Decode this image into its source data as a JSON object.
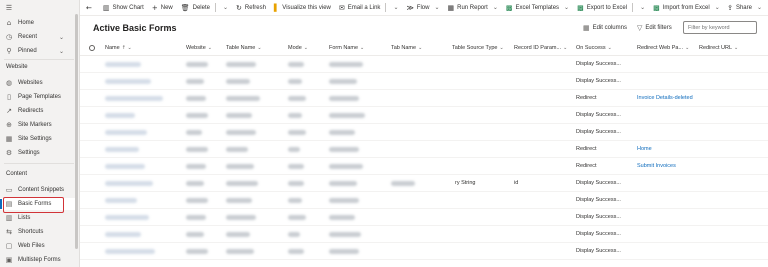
{
  "sidebar": {
    "menu_icon": "hamburger-icon",
    "top_items": [
      {
        "label": "Home",
        "icon": "home-icon"
      },
      {
        "label": "Recent",
        "icon": "clock-icon",
        "chevron": "v"
      },
      {
        "label": "Pinned",
        "icon": "pin-icon",
        "chevron": "v"
      }
    ],
    "section_website": "Website",
    "website_items": [
      {
        "label": "Websites",
        "icon": "globe-icon"
      },
      {
        "label": "Page Templates",
        "icon": "page-icon"
      },
      {
        "label": "Redirects",
        "icon": "redirect-icon"
      },
      {
        "label": "Site Markers",
        "icon": "marker-icon"
      },
      {
        "label": "Site Settings",
        "icon": "settings-icon"
      },
      {
        "label": "Settings",
        "icon": "gear-icon"
      }
    ],
    "section_content": "Content",
    "content_items": [
      {
        "label": "Content Snippets",
        "icon": "snippet-icon"
      },
      {
        "label": "Basic Forms",
        "icon": "form-icon",
        "selected": true
      },
      {
        "label": "Lists",
        "icon": "list-icon"
      },
      {
        "label": "Shortcuts",
        "icon": "shortcut-icon"
      },
      {
        "label": "Web Files",
        "icon": "file-icon"
      },
      {
        "label": "Multistep Forms",
        "icon": "multistep-icon"
      }
    ]
  },
  "commandbar": {
    "back_icon": "back-arrow-icon",
    "show_chart": "Show Chart",
    "new": "New",
    "delete": "Delete",
    "refresh": "Refresh",
    "visualize": "Visualize this view",
    "email_link": "Email a Link",
    "flow": "Flow",
    "run_report": "Run Report",
    "excel_templates": "Excel Templates",
    "export_excel": "Export to Excel",
    "import_excel": "Import from Excel",
    "share": "Share"
  },
  "view": {
    "title": "Active Basic Forms",
    "edit_columns": "Edit columns",
    "edit_filters": "Edit filters",
    "filter_placeholder": "Filter by keyword"
  },
  "grid": {
    "columns": [
      {
        "label": "Name",
        "sort": "↑ ⌄"
      },
      {
        "label": "Website",
        "sort": "⌄"
      },
      {
        "label": "Table Name",
        "sort": "⌄"
      },
      {
        "label": "Mode",
        "sort": "⌄"
      },
      {
        "label": "Form Name",
        "sort": "⌄"
      },
      {
        "label": "Tab Name",
        "sort": "⌄"
      },
      {
        "label": "Table Source Type",
        "sort": "⌄"
      },
      {
        "label": "Record ID Param...",
        "sort": "⌄"
      },
      {
        "label": "On Success",
        "sort": "⌄"
      },
      {
        "label": "Redirect Web Pa...",
        "sort": "⌄"
      },
      {
        "label": "Redirect URL",
        "sort": "⌄"
      }
    ],
    "rows": [
      {
        "source_type": "",
        "record_id": "",
        "on_success": "Display Success...",
        "redirect_page": ""
      },
      {
        "source_type": "",
        "record_id": "",
        "on_success": "Display Success...",
        "redirect_page": ""
      },
      {
        "source_type": "",
        "record_id": "",
        "on_success": "Redirect",
        "redirect_page": "Invoice Details-deleted"
      },
      {
        "source_type": "",
        "record_id": "",
        "on_success": "Display Success...",
        "redirect_page": ""
      },
      {
        "source_type": "",
        "record_id": "",
        "on_success": "Display Success...",
        "redirect_page": ""
      },
      {
        "source_type": "",
        "record_id": "",
        "on_success": "Redirect",
        "redirect_page": "Home"
      },
      {
        "source_type": "",
        "record_id": "",
        "on_success": "Redirect",
        "redirect_page": "Submit Invoices"
      },
      {
        "source_type": "ry String",
        "record_id": "id",
        "on_success": "Display Success...",
        "redirect_page": ""
      },
      {
        "source_type": "",
        "record_id": "",
        "on_success": "Display Success...",
        "redirect_page": ""
      },
      {
        "source_type": "",
        "record_id": "",
        "on_success": "Display Success...",
        "redirect_page": ""
      },
      {
        "source_type": "",
        "record_id": "",
        "on_success": "Display Success...",
        "redirect_page": ""
      },
      {
        "source_type": "",
        "record_id": "",
        "on_success": "Display Success...",
        "redirect_page": ""
      }
    ]
  },
  "colors": {
    "accent": "#0f6cbd",
    "highlight": "#d13438"
  }
}
